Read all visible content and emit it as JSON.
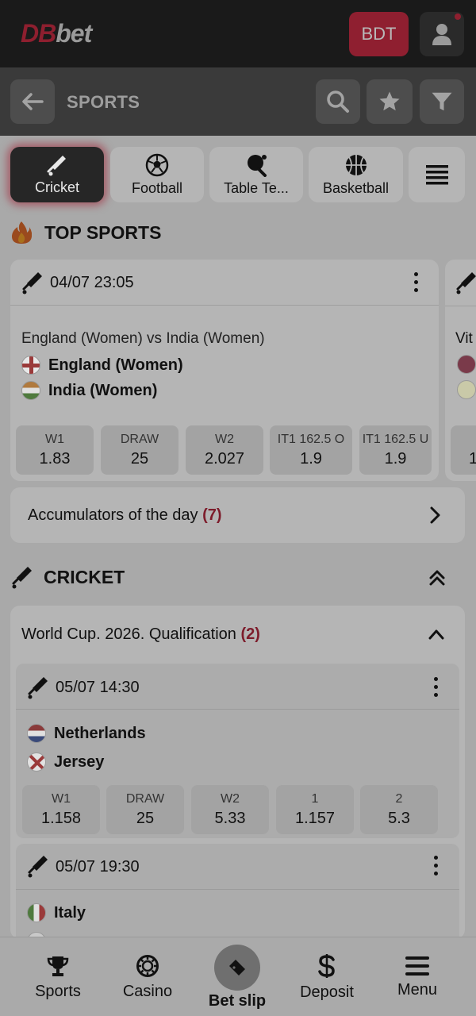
{
  "app": {
    "logo_db": "DB",
    "logo_bet": "bet",
    "currency_button": "BDT"
  },
  "header": {
    "title": "SPORTS"
  },
  "sport_tabs": [
    {
      "label": "Cricket",
      "icon": "cricket-bat-icon",
      "active": true
    },
    {
      "label": "Football",
      "icon": "football-icon",
      "active": false
    },
    {
      "label": "Table Te...",
      "icon": "table-tennis-icon",
      "active": false
    },
    {
      "label": "Basketball",
      "icon": "basketball-icon",
      "active": false
    }
  ],
  "top_sports": {
    "heading": "TOP SPORTS",
    "icon": "fire-icon",
    "match": {
      "time": "04/07 23:05",
      "title": "England (Women) vs India (Women)",
      "team1": "England (Women)",
      "team2": "India (Women)",
      "odds": [
        {
          "label": "W1",
          "value": "1.83"
        },
        {
          "label": "DRAW",
          "value": "25"
        },
        {
          "label": "W2",
          "value": "2.027"
        },
        {
          "label": "IT1 162.5 O",
          "value": "1.9"
        },
        {
          "label": "IT1 162.5 U",
          "value": "1.9"
        }
      ]
    },
    "peek_card_text": "Vit",
    "peek_card_value": "1"
  },
  "accumulators": {
    "label": "Accumulators of the day",
    "count": "(7)"
  },
  "cricket_section": {
    "heading": "CRICKET",
    "league": {
      "title": "World Cup. 2026. Qualification",
      "count": "(2)",
      "matches": [
        {
          "time": "05/07 14:30",
          "team1": "Netherlands",
          "team2": "Jersey",
          "odds": [
            {
              "label": "W1",
              "value": "1.158"
            },
            {
              "label": "DRAW",
              "value": "25"
            },
            {
              "label": "W2",
              "value": "5.33"
            },
            {
              "label": "1",
              "value": "1.157"
            },
            {
              "label": "2",
              "value": "5.3"
            }
          ]
        },
        {
          "time": "05/07 19:30",
          "team1": "Italy"
        }
      ]
    }
  },
  "bottom_nav": [
    {
      "label": "Sports",
      "icon": "trophy-icon"
    },
    {
      "label": "Casino",
      "icon": "casino-chip-icon"
    },
    {
      "label": "Bet slip",
      "icon": "ticket-icon"
    },
    {
      "label": "Deposit",
      "icon": "dollar-icon"
    },
    {
      "label": "Menu",
      "icon": "hamburger-menu-icon"
    }
  ]
}
